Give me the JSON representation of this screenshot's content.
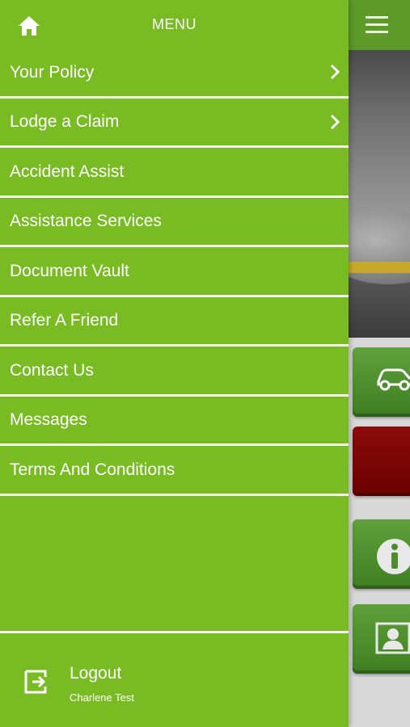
{
  "header": {
    "title": "MENU",
    "home_icon": "home-icon"
  },
  "menu": {
    "items": [
      {
        "label": "Your Policy",
        "has_chevron": true
      },
      {
        "label": "Lodge a Claim",
        "has_chevron": true
      },
      {
        "label": "Accident Assist",
        "has_chevron": false
      },
      {
        "label": "Assistance Services",
        "has_chevron": false
      },
      {
        "label": "Document Vault",
        "has_chevron": false
      },
      {
        "label": "Refer A Friend",
        "has_chevron": false
      },
      {
        "label": "Contact Us",
        "has_chevron": false
      },
      {
        "label": "Messages",
        "has_chevron": false
      },
      {
        "label": "Terms And Conditions",
        "has_chevron": false
      }
    ]
  },
  "footer": {
    "logout_label": "Logout",
    "user_name": "Charlene Test",
    "logout_icon": "logout-icon"
  },
  "background": {
    "hamburger_icon": "hamburger-icon",
    "tiles": [
      "car-icon",
      "red-tile",
      "info-icon",
      "profile-icon"
    ]
  },
  "colors": {
    "drawer": "#79bb23",
    "topbar": "#5d9a2a",
    "divider": "#f2f7ea",
    "tile_green": "#4a8c2c",
    "tile_red": "#7a0000"
  }
}
